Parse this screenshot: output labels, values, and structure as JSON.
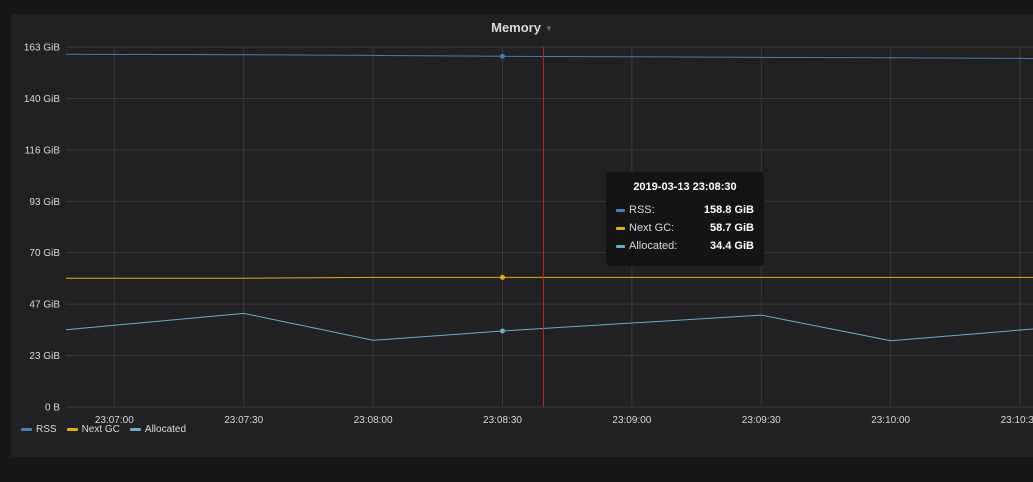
{
  "panel": {
    "title": "Memory"
  },
  "tooltip": {
    "time": "2019-03-13 23:08:30",
    "rows": [
      {
        "name": "RSS:",
        "value": "158.8 GiB",
        "color": "#447ebc"
      },
      {
        "name": "Next GC:",
        "value": "58.7 GiB",
        "color": "#e5ac0e"
      },
      {
        "name": "Allocated:",
        "value": "34.4 GiB",
        "color": "#64b0c8"
      }
    ]
  },
  "chart_data": {
    "type": "line",
    "title": "Memory",
    "y_ticks": [
      "0 B",
      "23 GiB",
      "47 GiB",
      "70 GiB",
      "93 GiB",
      "116 GiB",
      "140 GiB",
      "163 GiB"
    ],
    "y_tick_values": [
      0,
      23.3,
      46.6,
      69.9,
      93.1,
      116.4,
      139.7,
      163
    ],
    "ylim": [
      0,
      163
    ],
    "x_ticks": [
      "23:07:00",
      "23:07:30",
      "23:08:00",
      "23:08:30",
      "23:09:00",
      "23:09:30",
      "23:10:00",
      "23:10:30"
    ],
    "x_tick_seconds": [
      0,
      30,
      60,
      90,
      120,
      150,
      180,
      210
    ],
    "xlim_seconds": [
      -11.2,
      213
    ],
    "hover_time_seconds": 99.5,
    "grid": true,
    "legend_position": "bottom-left",
    "series": [
      {
        "name": "RSS",
        "color": "#447ebc",
        "x_seconds": [
          -11.2,
          30,
          60,
          90,
          120,
          150,
          180,
          213
        ],
        "values": [
          159.7,
          159.5,
          159.2,
          158.8,
          158.6,
          158.3,
          158.1,
          157.8
        ]
      },
      {
        "name": "Next GC",
        "color": "#e5ac0e",
        "x_seconds": [
          -11.2,
          30,
          60,
          90,
          120,
          150,
          180,
          213
        ],
        "values": [
          58.3,
          58.3,
          58.7,
          58.7,
          58.7,
          58.7,
          58.7,
          58.7
        ]
      },
      {
        "name": "Allocated",
        "color": "#64b0c8",
        "x_seconds": [
          -11.2,
          30,
          60,
          90,
          150,
          180,
          213
        ],
        "values": [
          35.0,
          42.4,
          30.2,
          34.4,
          41.6,
          30.0,
          35.3
        ]
      }
    ],
    "highlight_points_seconds": 90
  },
  "legend": [
    {
      "label": "RSS",
      "color": "#447ebc"
    },
    {
      "label": "Next GC",
      "color": "#e5ac0e"
    },
    {
      "label": "Allocated",
      "color": "#64b0c8"
    }
  ]
}
